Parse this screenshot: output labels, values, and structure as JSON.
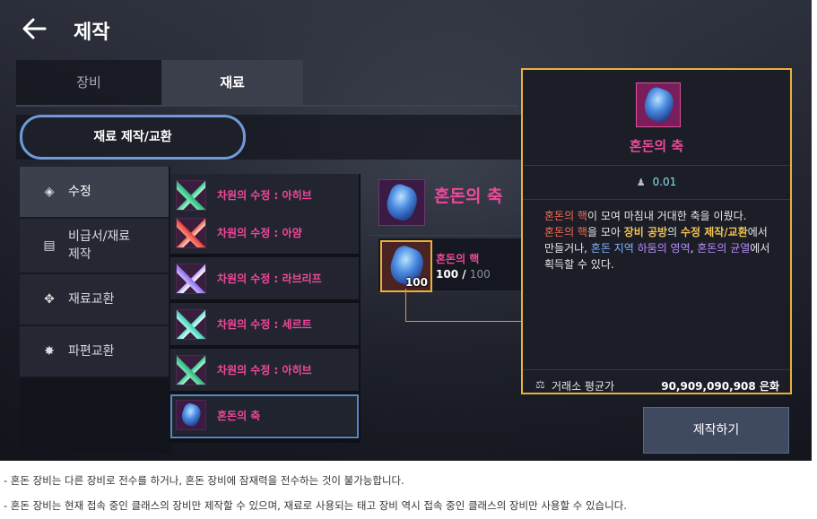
{
  "header": {
    "title": "제작"
  },
  "tabs": [
    {
      "label": "장비"
    },
    {
      "label": "재료"
    }
  ],
  "subtab": {
    "label": "재료 제작/교환"
  },
  "categories": [
    {
      "label": "수정",
      "icon": "crystal-icon"
    },
    {
      "label": "비급서/재료\n제작",
      "icon": "scroll-icon"
    },
    {
      "label": "재료교환",
      "icon": "lotus-icon"
    },
    {
      "label": "파편교환",
      "icon": "shard-icon"
    }
  ],
  "items": [
    {
      "name": "차원의 수정 : 아히브",
      "icon": "green-crystal-icon"
    },
    {
      "name": "차원의 수정 : 아얌",
      "icon": "red-crystal-icon"
    },
    {
      "name": "차원의 수정 : 라브리프",
      "icon": "purple-crystal-icon"
    },
    {
      "name": "차원의 수정 : 세르트",
      "icon": "cyan-crystal-icon"
    },
    {
      "name": "차원의 수정 : 아히브",
      "icon": "green-crystal-icon"
    },
    {
      "name": "혼돈의 축",
      "icon": "chaos-gem-icon"
    }
  ],
  "detail": {
    "name": "혼돈의 축",
    "material": {
      "name": "혼돈의 핵",
      "count": "100",
      "have": "100",
      "need": "100"
    }
  },
  "tooltip": {
    "name": "혼돈의 축",
    "weight": "0.01",
    "desc": {
      "p1": "혼돈의 핵",
      "p2": "이 모여 마침내 거대한 축을 이뤘다.",
      "p3": "혼돈의 핵",
      "p4": "을 모아 ",
      "p5": "장비 공방",
      "p6": "의 ",
      "p7": "수정 제작/교환",
      "p8": "에서 만들거나, ",
      "p9": "혼돈 지역",
      "p10": " ",
      "p11": "하둠의 영역",
      "p12": ", ",
      "p13": "혼돈의 균열",
      "p14": "에서 획득할 수 있다."
    },
    "price_label": "거래소 평균가",
    "price_value": "90,909,090,908 은화"
  },
  "make_button": "제작하기",
  "notes": [
    "- 혼돈 장비는 다른 장비로 전수를 하거나, 혼돈 장비에 잠재력을 전수하는 것이 불가능합니다.",
    "- 혼돈 장비는 현재 접속 중인 클래스의 장비만 제작할 수 있으며, 재료로 사용되는 태고 장비 역시 접속 중인 클래스의 장비만 사용할 수 있습니다."
  ],
  "colors": {
    "accent_pink": "#f0489a",
    "tooltip_border": "#e9b13c",
    "selected_outline": "#5a86c2"
  }
}
